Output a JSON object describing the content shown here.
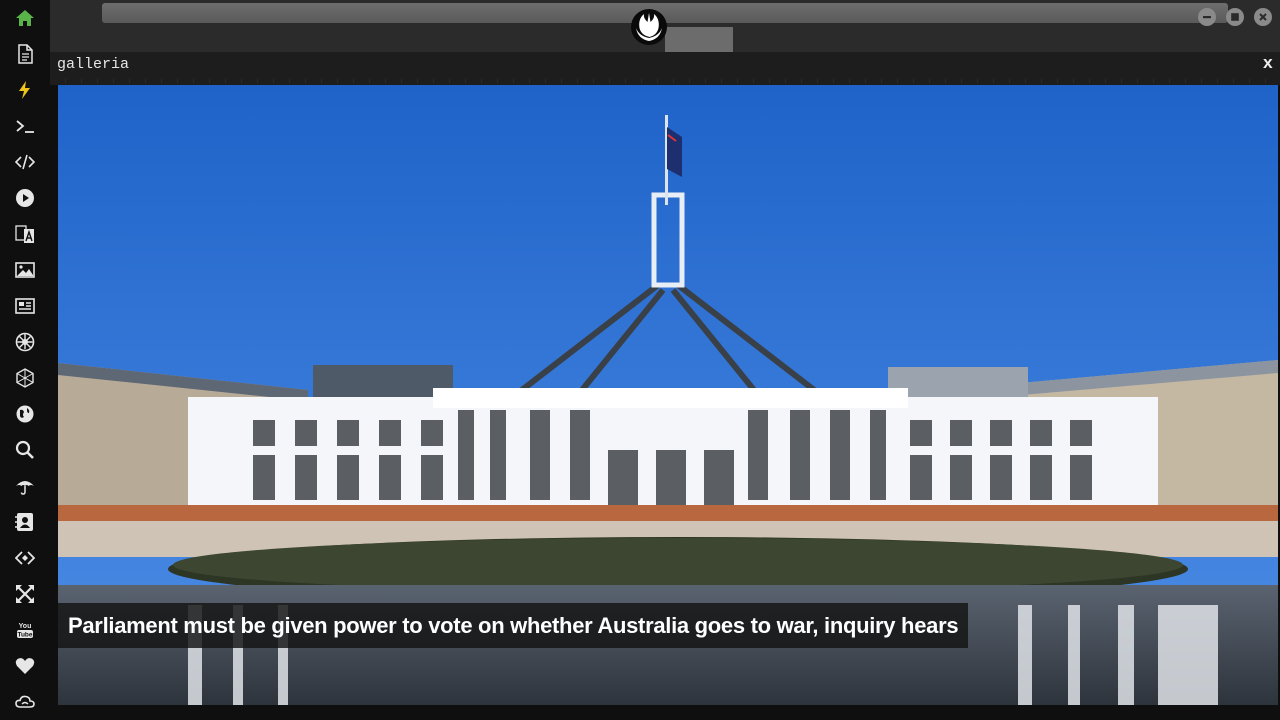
{
  "sidebar": {
    "items": [
      {
        "icon": "home-icon",
        "color": "#59b54a"
      },
      {
        "icon": "document-icon",
        "color": "#e6e6e6"
      },
      {
        "icon": "lightning-icon",
        "color": "#f0c419"
      },
      {
        "icon": "terminal-icon",
        "color": "#e6e6e6"
      },
      {
        "icon": "code-icon",
        "color": "#e6e6e6"
      },
      {
        "icon": "play-icon",
        "color": "#e6e6e6"
      },
      {
        "icon": "translate-icon",
        "color": "#e6e6e6"
      },
      {
        "icon": "image-icon",
        "color": "#e6e6e6"
      },
      {
        "icon": "news-icon",
        "color": "#e6e6e6"
      },
      {
        "icon": "galactic-empire-icon",
        "color": "#e6e6e6"
      },
      {
        "icon": "hexagon-icon",
        "color": "#e6e6e6"
      },
      {
        "icon": "globe-icon",
        "color": "#e6e6e6"
      },
      {
        "icon": "search-icon",
        "color": "#e6e6e6"
      },
      {
        "icon": "umbrella-icon",
        "color": "#e6e6e6"
      },
      {
        "icon": "contact-card-icon",
        "color": "#e6e6e6"
      },
      {
        "icon": "code-diamond-icon",
        "color": "#e6e6e6"
      },
      {
        "icon": "expand-icon",
        "color": "#e6e6e6"
      },
      {
        "icon": "youtube-icon",
        "color": "#e6e6e6"
      },
      {
        "icon": "heart-icon",
        "color": "#e6e6e6"
      },
      {
        "icon": "cloud-icon",
        "color": "#e6e6e6"
      }
    ]
  },
  "header": {
    "logo_icon": "rebel-alliance-icon",
    "window_buttons": [
      "minimize-icon",
      "maximize-icon",
      "close-icon"
    ]
  },
  "pane": {
    "title": "galleria",
    "close_label": "x"
  },
  "gallery": {
    "caption": "Parliament must be given power to vote on whether Australia goes to war, inquiry hears"
  }
}
